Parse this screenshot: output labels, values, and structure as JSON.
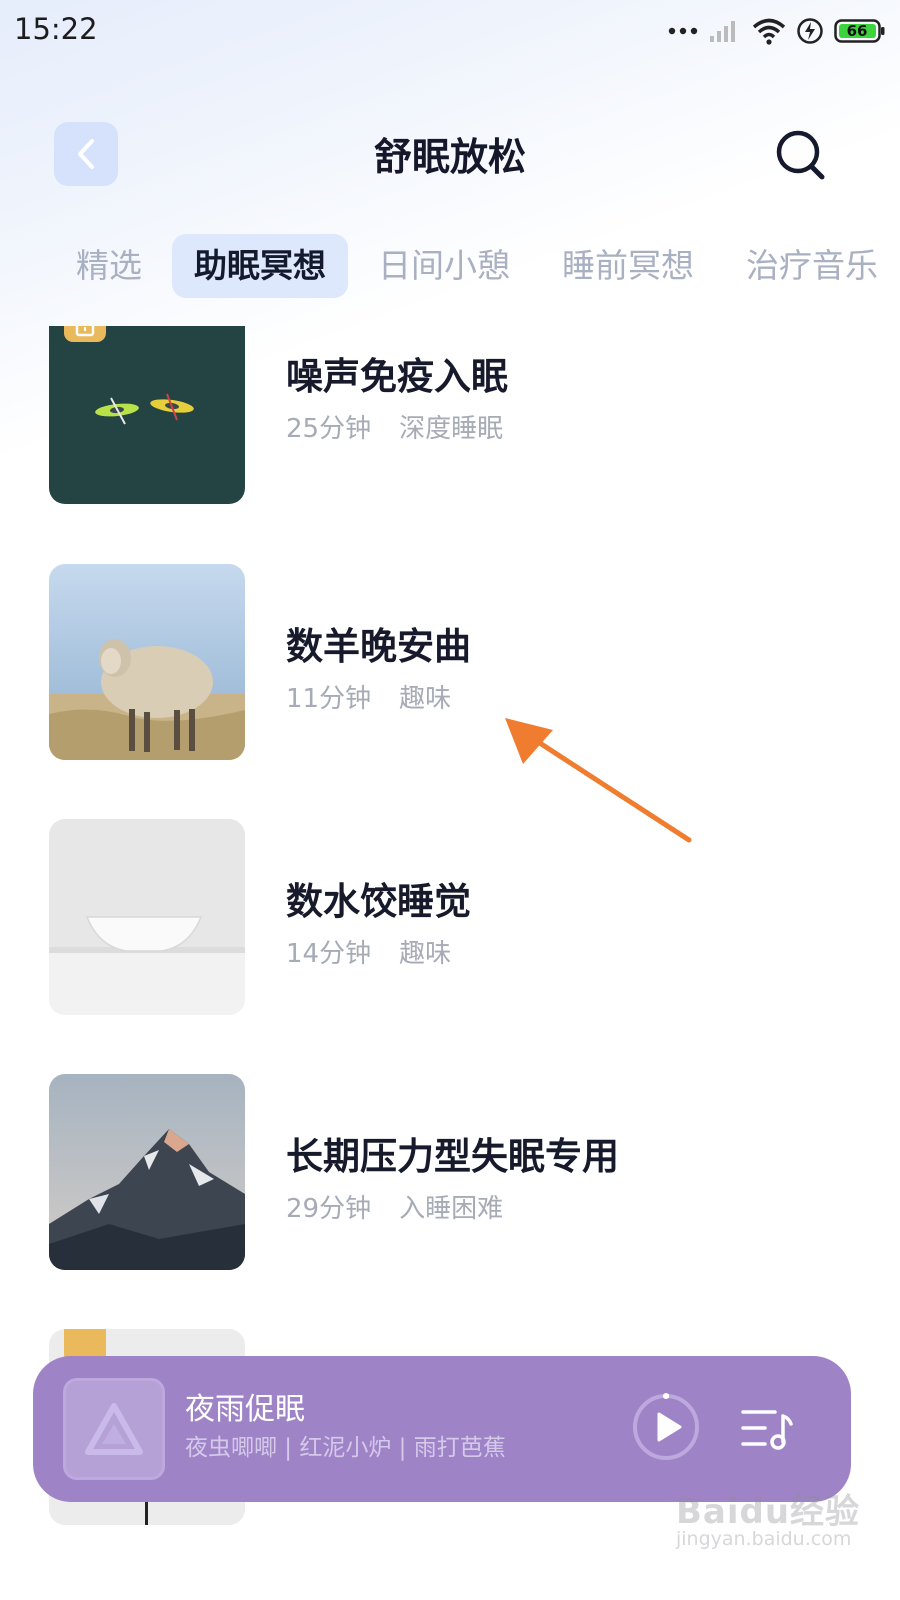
{
  "status_bar": {
    "time": "15:22",
    "battery_level": "66",
    "icons": [
      "more-dots-icon",
      "signal-icon",
      "wifi-icon",
      "charging-icon",
      "battery-icon"
    ]
  },
  "header": {
    "title": "舒眠放松",
    "back_icon": "chevron-left-icon",
    "search_icon": "search-icon"
  },
  "tabs": [
    {
      "label": "精选",
      "active": false
    },
    {
      "label": "助眠冥想",
      "active": true
    },
    {
      "label": "日间小憩",
      "active": false
    },
    {
      "label": "睡前冥想",
      "active": false
    },
    {
      "label": "治疗音乐",
      "active": false
    }
  ],
  "items": [
    {
      "title": "噪声免疫入眠",
      "duration": "25分钟",
      "tag": "深度睡眠",
      "locked": true,
      "thumb": "kayaks"
    },
    {
      "title": "数羊晚安曲",
      "duration": "11分钟",
      "tag": "趣味",
      "locked": false,
      "thumb": "sheep"
    },
    {
      "title": "数水饺睡觉",
      "duration": "14分钟",
      "tag": "趣味",
      "locked": false,
      "thumb": "bowl"
    },
    {
      "title": "长期压力型失眠专用",
      "duration": "29分钟",
      "tag": "入睡困难",
      "locked": false,
      "thumb": "mountain"
    }
  ],
  "player": {
    "title": "夜雨促眠",
    "subtitle": "夜虫唧唧 | 红泥小炉 | 雨打芭蕉",
    "play_icon": "play-icon",
    "playlist_icon": "playlist-icon"
  },
  "watermark": {
    "logo": "Baidu经验",
    "url": "jingyan.baidu.com"
  },
  "colors": {
    "accent_tab_bg": "#dde8fc",
    "player_bg": "#9e84c7",
    "lock_badge": "#e9b95b",
    "annotation_arrow": "#f07c30"
  }
}
